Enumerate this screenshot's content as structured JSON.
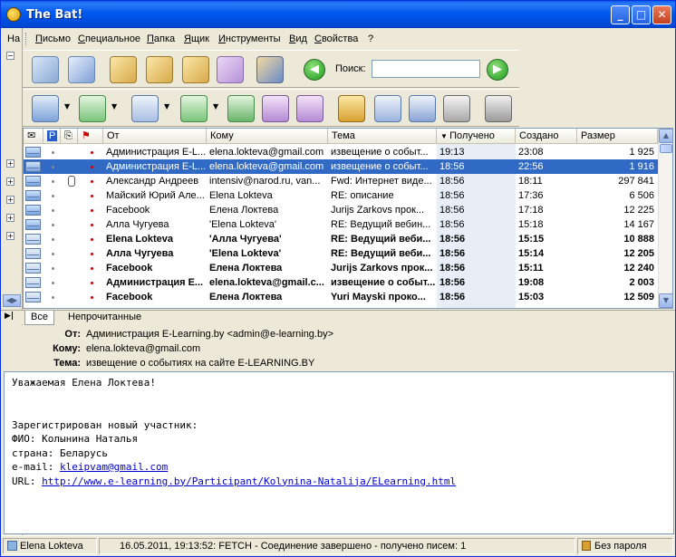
{
  "window": {
    "title": "The Bat!"
  },
  "menu": [
    "Письмо",
    "Специальное",
    "Папка",
    "Ящик",
    "Инструменты",
    "Вид",
    "Свойства",
    "?"
  ],
  "left_menu_fragment": "На",
  "search": {
    "label": "Поиск:",
    "value": ""
  },
  "columns": [
    "От",
    "Кому",
    "Тема",
    "Получено",
    "Создано",
    "Размер"
  ],
  "messages": [
    {
      "from": "Администрация E-L...",
      "to": "elena.lokteva@gmail.com",
      "subject": "извещение о событ...",
      "received": "19:13",
      "created": "23:08",
      "size": "1 925",
      "bold": false,
      "selected": false,
      "attach": false
    },
    {
      "from": "Администрация E-L...",
      "to": "elena.lokteva@gmail.com",
      "subject": "извещение о событ...",
      "received": "18:56",
      "created": "22:56",
      "size": "1 916",
      "bold": false,
      "selected": true,
      "attach": false
    },
    {
      "from": "Александр Андреев",
      "to": "intensiv@narod.ru, van...",
      "subject": "Fwd: Интернет виде...",
      "received": "18:56",
      "created": "18:11",
      "size": "297 841",
      "bold": false,
      "selected": false,
      "attach": true
    },
    {
      "from": "Майский Юрий Але...",
      "to": "Elena Lokteva",
      "subject": "RE: описание",
      "received": "18:56",
      "created": "17:36",
      "size": "6 506",
      "bold": false,
      "selected": false,
      "attach": false
    },
    {
      "from": "Facebook",
      "to": "Елена Локтева",
      "subject": "Jurijs Zarkovs прок...",
      "received": "18:56",
      "created": "17:18",
      "size": "12 225",
      "bold": false,
      "selected": false,
      "attach": false
    },
    {
      "from": "Алла Чугуева",
      "to": "'Elena Lokteva'",
      "subject": "RE: Ведущий вебин...",
      "received": "18:56",
      "created": "15:18",
      "size": "14 167",
      "bold": false,
      "selected": false,
      "attach": false
    },
    {
      "from": "Elena Lokteva",
      "to": "'Алла Чугуева'",
      "subject": "RE: Ведущий веби...",
      "received": "18:56",
      "created": "15:15",
      "size": "10 888",
      "bold": true,
      "selected": false,
      "attach": false
    },
    {
      "from": "Алла Чугуева",
      "to": "'Elena Lokteva'",
      "subject": "RE: Ведущий веби...",
      "received": "18:56",
      "created": "15:14",
      "size": "12 205",
      "bold": true,
      "selected": false,
      "attach": false
    },
    {
      "from": "Facebook",
      "to": "Елена Локтева",
      "subject": "Jurijs Zarkovs прок...",
      "received": "18:56",
      "created": "15:11",
      "size": "12 240",
      "bold": true,
      "selected": false,
      "attach": false
    },
    {
      "from": "Администрация E...",
      "to": "elena.lokteva@gmail.c...",
      "subject": "извещение о событ...",
      "received": "18:56",
      "created": "19:08",
      "size": "2 003",
      "bold": true,
      "selected": false,
      "attach": false
    },
    {
      "from": "Facebook",
      "to": "Елена Локтева",
      "subject": "Yuri Mayski проко...",
      "received": "18:56",
      "created": "15:03",
      "size": "12 509",
      "bold": true,
      "selected": false,
      "attach": false
    }
  ],
  "tabs": [
    "Все",
    "Непрочитанные"
  ],
  "header": {
    "from_label": "От:",
    "from": "Администрация E-Learning.by <admin@e-learning.by>",
    "to_label": "Кому:",
    "to": "elena.lokteva@gmail.com",
    "subject_label": "Тема:",
    "subject": "извещение о событиях на сайте E-LEARNING.BY"
  },
  "body": {
    "greeting": "Уважаемая Елена Локтева!",
    "line1": "Зарегистрирован новый участник:",
    "fio": "ФИО: Колынина Наталья",
    "country": "страна: Беларусь",
    "email_prefix": "e-mail: ",
    "email": "kleipvam@gmail.com",
    "url_prefix": "URL: ",
    "url": "http://www.e-learning.by/Participant/Kolynina-Natalija/ELearning.html"
  },
  "status": {
    "account": "Elena Lokteva",
    "log": "16.05.2011, 19:13:52: FETCH - Соединение завершено - получено писем: 1",
    "password": "Без пароля"
  },
  "colors": {
    "selection": "#316ac5",
    "titlebar": "#0058ee",
    "link": "#0000cc"
  }
}
